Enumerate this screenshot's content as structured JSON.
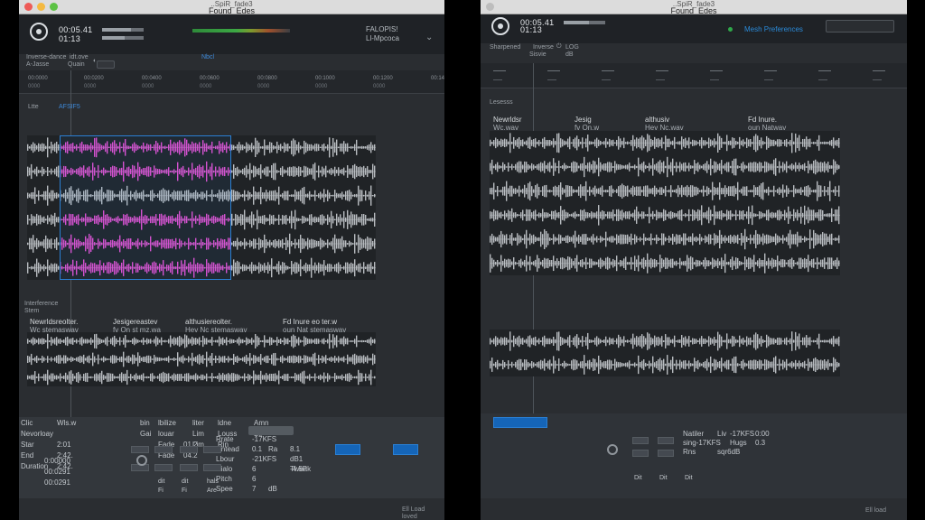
{
  "left": {
    "title_top": "..SpiR_fade3",
    "title_main": "Found_Edes",
    "header": {
      "time1": "00:05.41",
      "time2": "01:13",
      "status1": "FALOPIS!",
      "status2": "Ll-Mpcoca",
      "meter1": 0.7,
      "meter2": 0.55
    },
    "controls": {
      "c1": "Inverse-dance",
      "c2": "idt.ove",
      "c3": "A-Jasse",
      "c4": "Quain",
      "hi": "Nbcl"
    },
    "ruler": {
      "top": [
        "00:0000",
        "00:0200",
        "00:0400",
        "00:0600",
        "00:0800",
        "00:1000",
        "00:1200",
        "00:1400"
      ],
      "bottom": [
        "0000",
        "0000",
        "0000",
        "0000",
        "0000",
        "0000",
        "0000"
      ]
    },
    "section1": "Ltte",
    "section1_label": "AFSIF5",
    "section2a": "Interference",
    "section2b": "Stem",
    "tracks": [
      {
        "name": "Newrldsreolter.",
        "sub": "Wc stemaswav"
      },
      {
        "name": "Jesigereastev",
        "sub": "fv On st mz.wa"
      },
      {
        "name": "althusiereolter.",
        "sub": "Hev Nc stemaswav"
      },
      {
        "name": "Fd Inure eo ter.w",
        "sub": "oun Nat stemaswav"
      }
    ],
    "panel": {
      "col1": [
        "Clic",
        "Nevorloay",
        "Star",
        "End",
        "Duration"
      ],
      "col1b": [
        "Wls.w",
        "",
        "2:01",
        "2:42.",
        "2:42."
      ],
      "col1c": [
        "",
        "",
        "0:00000",
        "00:0291",
        "00:0291"
      ],
      "col2": [
        "bin",
        "Gai",
        "",
        "",
        ""
      ],
      "col3": [
        "lbilize",
        "louar",
        "Fade",
        "Fade",
        ""
      ],
      "col3b": [
        "",
        "",
        "01.2",
        "04.2",
        ""
      ],
      "col4": [
        "liter",
        "Lim",
        "Lim",
        "",
        ""
      ],
      "col5": [
        "ldne",
        "Louss",
        "Rin",
        "",
        ""
      ],
      "col6": [
        "Amn",
        "Bir",
        "",
        "",
        ""
      ],
      "rows": [
        "Rrate",
        "Untead",
        "Lbour",
        "Dialo",
        "Pitch",
        "Spee"
      ],
      "vals": [
        "-17KFS",
        "0.1",
        "-21KFS",
        "6",
        "6",
        "7"
      ],
      "vals2": [
        "",
        "Ra",
        "",
        "",
        "",
        "dB"
      ],
      "vals3": [
        "",
        "8.1",
        "dB1",
        "Tweak",
        "",
        ""
      ],
      "vals4": [
        "",
        "",
        "",
        "-4.5P",
        "",
        ""
      ],
      "btns": [
        "dit",
        "dit",
        "hals",
        "Fi",
        "Fi",
        "Are"
      ]
    },
    "footer": [
      "Ell Load",
      "loved"
    ]
  },
  "right": {
    "title_top": "..SpiR_fade3",
    "title_main": "Found_Edes",
    "header": {
      "time1": "00:05.41",
      "time2": "01:13",
      "status1": "Mesh Preferences",
      "meter1": 0.6
    },
    "controls": {
      "c1": "Sharpened",
      "c2": "Inverse",
      "c3": "LOG",
      "c4": "Sisvie",
      "c5": "dB"
    },
    "tracks": [
      {
        "name": "Newrldsr",
        "sub": "Wc.wav"
      },
      {
        "name": "Jesig",
        "sub": "fv On.w"
      },
      {
        "name": "althusiv",
        "sub": "Hev Nc.wav"
      },
      {
        "name": "Fd Inure.",
        "sub": "oun Natwav"
      }
    ],
    "section1": "Lesesss",
    "panel": {
      "row1": [
        "Natiler",
        "Liv",
        "-17KFS",
        "0:00"
      ],
      "row2": [
        "sing-17KFS",
        "Hugs",
        "0.3"
      ],
      "row3": [
        "Rns",
        "sqr6dB"
      ],
      "btns": [
        "Dit",
        "Dit",
        "Dit"
      ]
    },
    "footer": [
      "Ell load"
    ]
  }
}
